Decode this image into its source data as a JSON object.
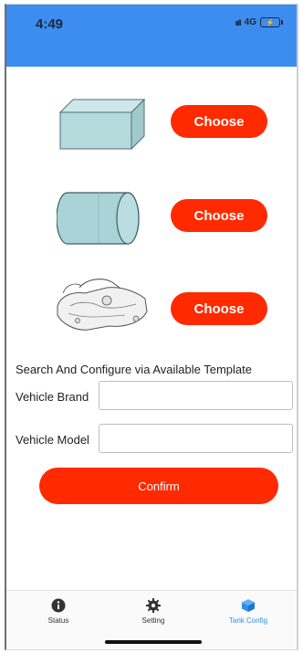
{
  "status_bar": {
    "time": "4:49",
    "network": "4G",
    "signal": "ııll"
  },
  "tank_options": [
    {
      "shape": "rectangular-tank-icon",
      "button_label": "Choose"
    },
    {
      "shape": "cylindrical-tank-icon",
      "button_label": "Choose"
    },
    {
      "shape": "vehicle-tank-icon",
      "button_label": "Choose"
    }
  ],
  "template_section": {
    "title": "Search And Configure via Available Template",
    "brand_label": "Vehicle Brand",
    "brand_value": "",
    "model_label": "Vehicle Model",
    "model_value": "",
    "confirm_label": "Confirm"
  },
  "tabbar": {
    "items": [
      {
        "label": "Status",
        "icon": "info-icon"
      },
      {
        "label": "Setting",
        "icon": "gear-icon"
      },
      {
        "label": "Tank Config",
        "icon": "cube-icon",
        "active": true
      }
    ]
  },
  "colors": {
    "accent": "#ff2a00",
    "header": "#3d8cf0",
    "active_tab": "#2f8fe8"
  }
}
